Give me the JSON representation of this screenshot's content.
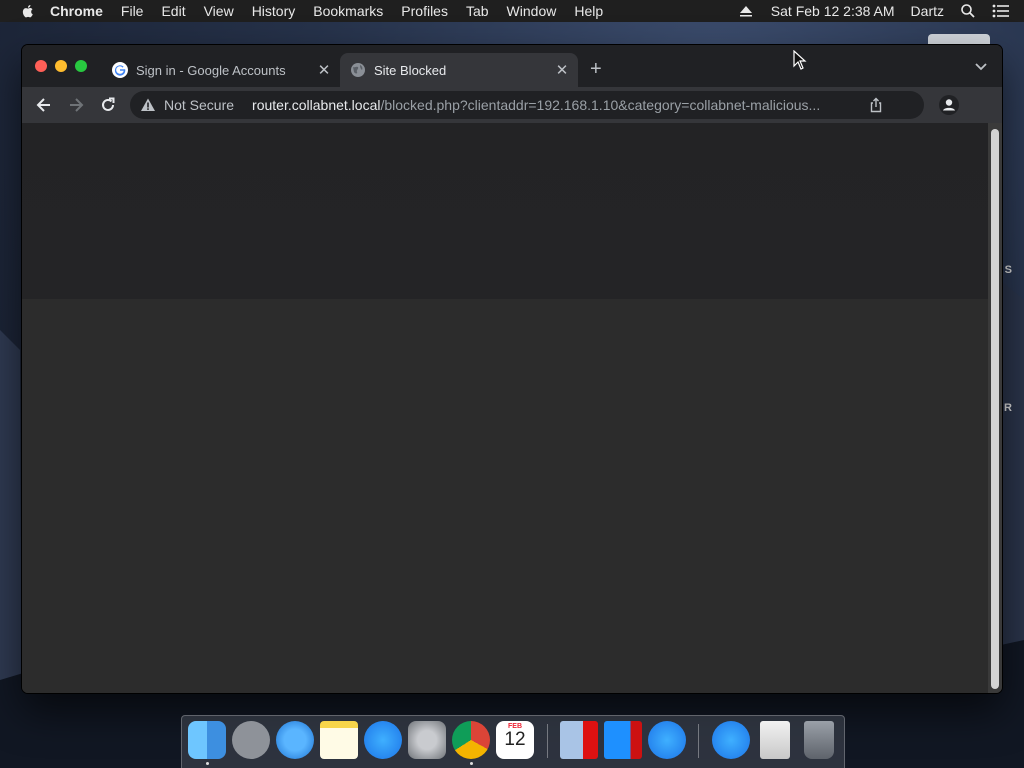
{
  "menubar": {
    "apple_icon": "apple-icon",
    "items": [
      "Chrome",
      "File",
      "Edit",
      "View",
      "History",
      "Bookmarks",
      "Profiles",
      "Tab",
      "Window",
      "Help"
    ],
    "datetime": "Sat Feb 12  2:38 AM",
    "user": "Dartz"
  },
  "side_labels": [
    "S",
    "R"
  ],
  "browser": {
    "tabs": [
      {
        "title": "Sign in - Google Accounts",
        "icon": "google-icon",
        "active": false
      },
      {
        "title": "Site Blocked",
        "icon": "globe-icon",
        "active": true
      }
    ],
    "address": {
      "security": "Not Secure",
      "host": "router.collabnet.local",
      "path": "/blocked.php?clientaddr=192.168.1.10&category=collabnet-malicious..."
    }
  },
  "dock": {
    "calendar_month": "FEB",
    "calendar_day": "12",
    "apps": [
      "finder-icon",
      "launchpad-icon",
      "safari-icon",
      "notes-icon",
      "app-store-icon",
      "system-preferences-icon",
      "chrome-icon",
      "calendar-icon",
      "parallels-icon",
      "windows-icon",
      "app-store-icon",
      "app-store-icon",
      "file-icon",
      "trash-icon"
    ]
  }
}
